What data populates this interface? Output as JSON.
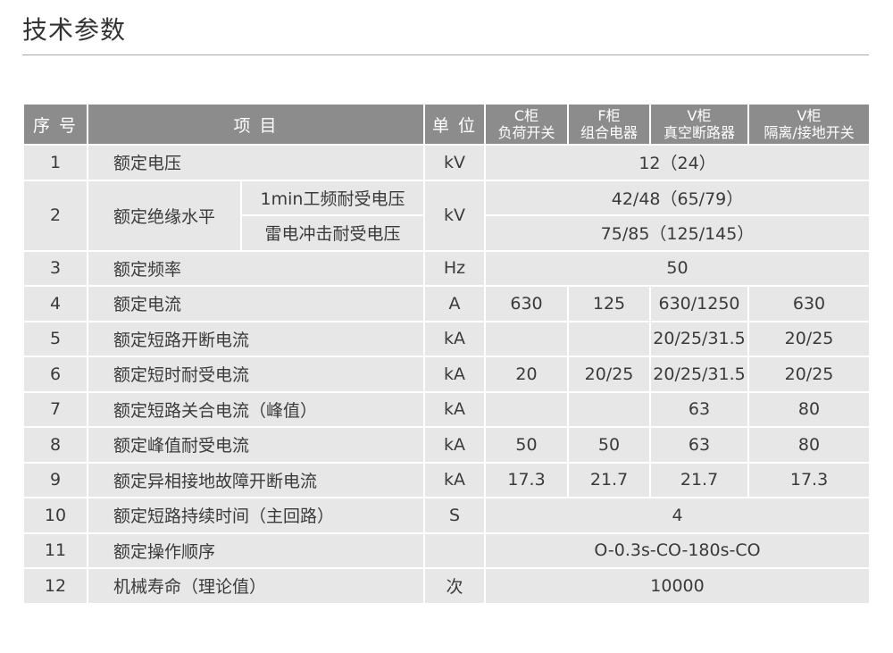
{
  "title": "技术参数",
  "headers": {
    "seq": "序 号",
    "item": "项 目",
    "unit": "单 位",
    "cabinets": [
      {
        "line1": "C柜",
        "line2": "负荷开关"
      },
      {
        "line1": "F柜",
        "line2": "组合电器"
      },
      {
        "line1": "V柜",
        "line2": "真空断路器"
      },
      {
        "line1": "V柜",
        "line2": "隔离/接地开关"
      }
    ]
  },
  "rows": {
    "r1": {
      "seq": "1",
      "item": "额定电压",
      "unit": "kV",
      "value": "12（24）"
    },
    "r2": {
      "seq": "2",
      "item": "额定绝缘水平",
      "sub1": "1min工频耐受电压",
      "sub2": "雷电冲击耐受电压",
      "unit": "kV",
      "value1": "42/48（65/79）",
      "value2": "75/85（125/145）"
    },
    "r3": {
      "seq": "3",
      "item": "额定频率",
      "unit": "Hz",
      "value": "50"
    },
    "r4": {
      "seq": "4",
      "item": "额定电流",
      "unit": "A",
      "c": "630",
      "f": "125",
      "v": "630/1250",
      "vi": "630"
    },
    "r5": {
      "seq": "5",
      "item": "额定短路开断电流",
      "unit": "kA",
      "c": "",
      "f": "",
      "v": "20/25/31.5",
      "vi": "20/25"
    },
    "r6": {
      "seq": "6",
      "item": "额定短时耐受电流",
      "unit": "kA",
      "c": "20",
      "f": "20/25",
      "v": "20/25/31.5",
      "vi": "20/25"
    },
    "r7": {
      "seq": "7",
      "item": "额定短路关合电流（峰值）",
      "unit": "kA",
      "c": "",
      "f": "",
      "v": "63",
      "vi": "80"
    },
    "r8": {
      "seq": "8",
      "item": "额定峰值耐受电流",
      "unit": "kA",
      "c": "50",
      "f": "50",
      "v": "63",
      "vi": "80"
    },
    "r9": {
      "seq": "9",
      "item": "额定异相接地故障开断电流",
      "unit": "kA",
      "c": "17.3",
      "f": "21.7",
      "v": "21.7",
      "vi": "17.3"
    },
    "r10": {
      "seq": "10",
      "item": "额定短路持续时间（主回路）",
      "unit": "S",
      "value": "4"
    },
    "r11": {
      "seq": "11",
      "item": "额定操作顺序",
      "unit": "",
      "value": "O-0.3s-CO-180s-CO"
    },
    "r12": {
      "seq": "12",
      "item": "机械寿命（理论值）",
      "unit": "次",
      "value": "10000"
    }
  }
}
